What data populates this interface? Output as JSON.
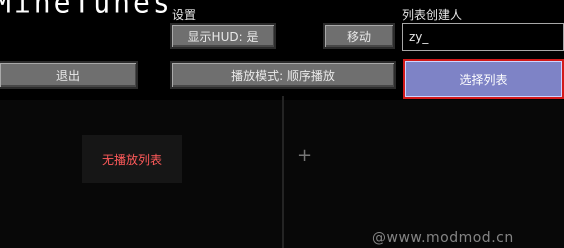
{
  "header": {
    "title": "MineTunes"
  },
  "settings": {
    "label": "设置",
    "hud_button": "显示HUD: 是",
    "move_button": "移动",
    "playback_button": "播放模式: 顺序播放"
  },
  "creator": {
    "label": "列表创建人",
    "value": "zy_"
  },
  "buttons": {
    "exit": "退出",
    "select_list": "选择列表"
  },
  "playlist": {
    "empty_text": "无播放列表"
  },
  "add_symbol": "+",
  "watermark": "@www.modmod.cn",
  "colors": {
    "selected_button": "#7e83c6",
    "selected_border": "#d21919",
    "empty_text": "#ff5a5a"
  }
}
